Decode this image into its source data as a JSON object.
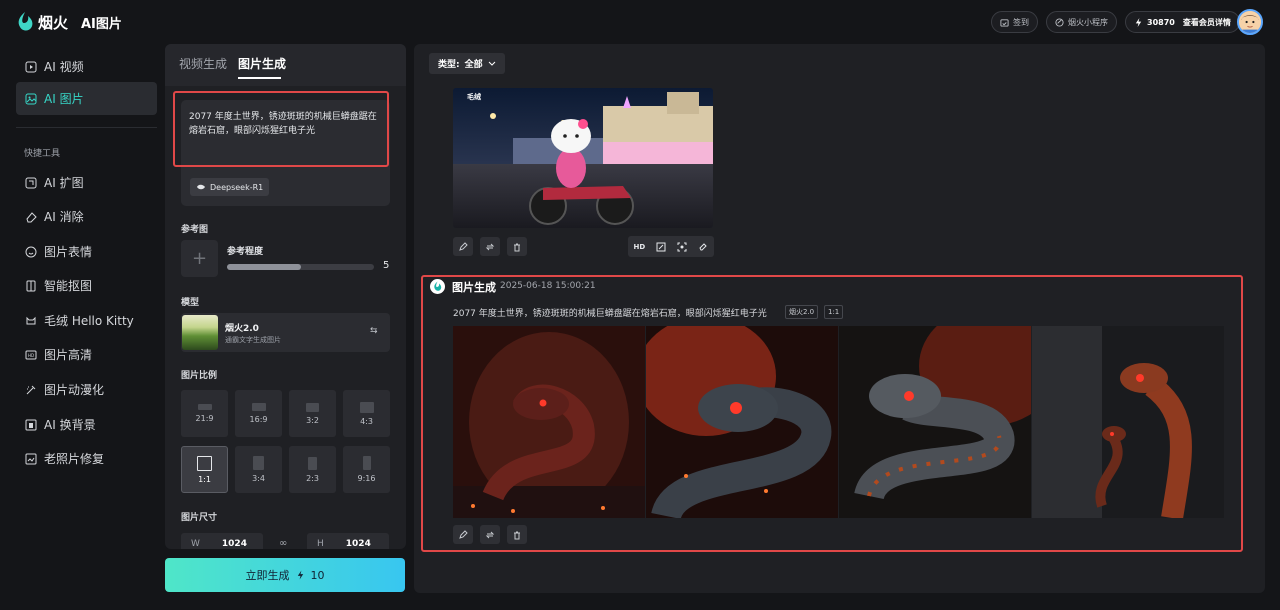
{
  "header": {
    "logo_text": "烟火",
    "app_title": "AI图片",
    "checkin_label": "签到",
    "miniprogram_label": "烟火小程序",
    "credits": "30870",
    "member_label": "查看会员详情"
  },
  "sidebar": {
    "items": [
      {
        "label": "AI 视频",
        "icon": "video-icon"
      },
      {
        "label": "AI 图片",
        "icon": "image-icon",
        "active": true
      }
    ],
    "section_title": "快捷工具",
    "tools": [
      {
        "label": "AI 扩图",
        "icon": "expand-icon"
      },
      {
        "label": "AI 消除",
        "icon": "eraser-icon"
      },
      {
        "label": "图片表情",
        "icon": "smile-icon"
      },
      {
        "label": "智能抠图",
        "icon": "cutout-icon"
      },
      {
        "label": "毛绒 Hello Kitty",
        "icon": "plush-icon"
      },
      {
        "label": "图片高清",
        "icon": "hd-icon"
      },
      {
        "label": "图片动漫化",
        "icon": "anime-icon"
      },
      {
        "label": "AI 换背景",
        "icon": "background-icon"
      },
      {
        "label": "老照片修复",
        "icon": "photo-repair-icon"
      }
    ]
  },
  "panel": {
    "tabs": [
      "视频生成",
      "图片生成"
    ],
    "active_tab": "图片生成",
    "prompt": "2077 年度土世界，锈迹斑斑的机械巨蟒盘踞在熔岩石窟，眼部闪烁猩红电子光",
    "deepseek_label": "Deepseek-R1",
    "reference_title": "参考图",
    "reference_strength_label": "参考程度",
    "reference_strength_value": "5",
    "reference_strength_fraction": 0.5,
    "model_title": "模型",
    "model_name": "烟火2.0",
    "model_desc": "通霸文字生成图片",
    "ratio_title": "图片比例",
    "ratios": [
      "21:9",
      "16:9",
      "3:2",
      "4:3",
      "1:1",
      "3:4",
      "2:3",
      "9:16"
    ],
    "selected_ratio": "1:1",
    "size_title": "图片尺寸",
    "width_label": "W",
    "width_value": "1024",
    "height_label": "H",
    "height_value": "1024",
    "generate_label": "立即生成",
    "generate_cost": "10"
  },
  "main": {
    "type_filter_label": "类型:",
    "type_filter_value": "全部",
    "top_image_tag": "毛绒",
    "top_tools": [
      "HD"
    ],
    "generation": {
      "title": "图片生成",
      "timestamp": "2025-06-18 15:00:21",
      "prompt": "2077 年度土世界，锈迹斑斑的机械巨蟒盘踞在熔岩石窟，眼部闪烁猩红电子光",
      "model_badge": "烟火2.0",
      "ratio_badge": "1:1"
    }
  },
  "colors": {
    "accent": "#37d7c8",
    "highlight_border": "#e04848",
    "generate_gradient_start": "#4fe6c8",
    "generate_gradient_end": "#38c6f0"
  }
}
